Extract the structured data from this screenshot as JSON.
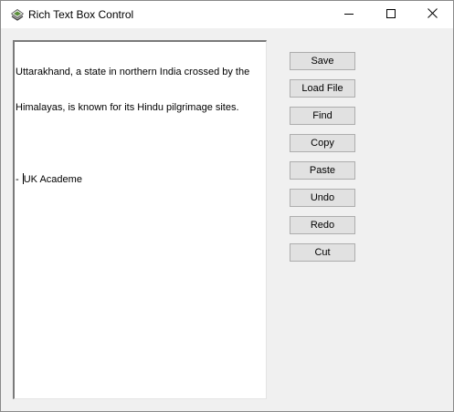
{
  "window": {
    "title": "Rich Text Box Control"
  },
  "editor": {
    "lines": [
      "Uttarakhand, a state in northern India crossed by the",
      "Himalayas, is known for its Hindu pilgrimage sites.",
      "",
      "- UK Academe"
    ]
  },
  "buttons": {
    "save": "Save",
    "load_file": "Load File",
    "find": "Find",
    "copy": "Copy",
    "paste": "Paste",
    "undo": "Undo",
    "redo": "Redo",
    "cut": "Cut"
  },
  "icons": {
    "app": "rich-text-app-icon",
    "minimize": "minimize-icon",
    "maximize": "maximize-icon",
    "close": "close-icon"
  },
  "colors": {
    "button_face": "#e1e1e1",
    "button_border": "#adadad",
    "client_background": "#f0f0f0",
    "editor_background": "#ffffff"
  }
}
